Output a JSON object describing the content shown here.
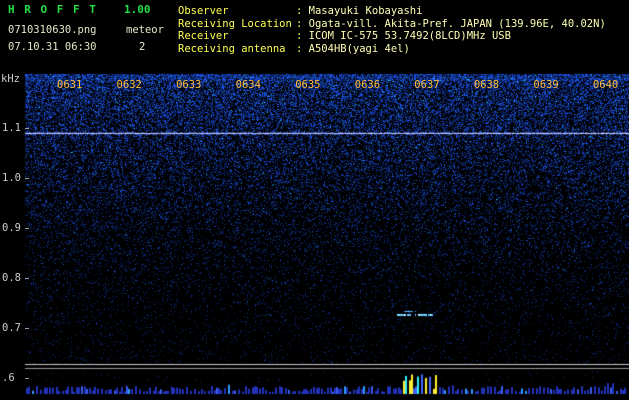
{
  "header": {
    "title": "H R O F F T",
    "version": "1.00",
    "filename": "0710310630.png",
    "meteor_label": "meteor",
    "meteor_count": "2",
    "timestamp": "07.10.31 06:30"
  },
  "info_separator": ": ",
  "info_rows": [
    {
      "label": "Observer",
      "value": "Masayuki Kobayashi"
    },
    {
      "label": "Receiving Location",
      "value": "Ogata-vill. Akita-Pref. JAPAN (139.96E, 40.02N)"
    },
    {
      "label": "Receiver",
      "value": "ICOM IC-575 53.7492(8LCD)MHz USB"
    },
    {
      "label": "Receiving antenna",
      "value": "A504HB(yagi 4el)"
    }
  ],
  "spectrogram": {
    "freq_unit_label": "kHz",
    "time_labels": [
      "0631",
      "0632",
      "0633",
      "0634",
      "0635",
      "0636",
      "0637",
      "0638",
      "0639",
      "0640"
    ],
    "freq_labels": [
      "1.1",
      "1.0",
      "0.9",
      "0.8",
      "0.7",
      ".6"
    ],
    "features": {
      "carrier_line_freq_khz": 1.09,
      "meteor_echo": {
        "time_label": "0637",
        "freq_khz": 0.73
      }
    }
  },
  "colors": {
    "background": "#000000",
    "title_green": "#22dd44",
    "header_text": "#e6e6c8",
    "info_label_yellow": "#ffff55",
    "info_value": "#ffffb4",
    "time_label_orange": "#ffbe3c",
    "freq_label_gray": "#cccccc",
    "noise_blue": "#2233ff",
    "carrier_line": "#c8d2ff",
    "echo_cyan": "#7dffff",
    "peak_yellow": "#ffee33",
    "bar_blue": "#2233bb",
    "panel_line": "#c8c8c8"
  }
}
